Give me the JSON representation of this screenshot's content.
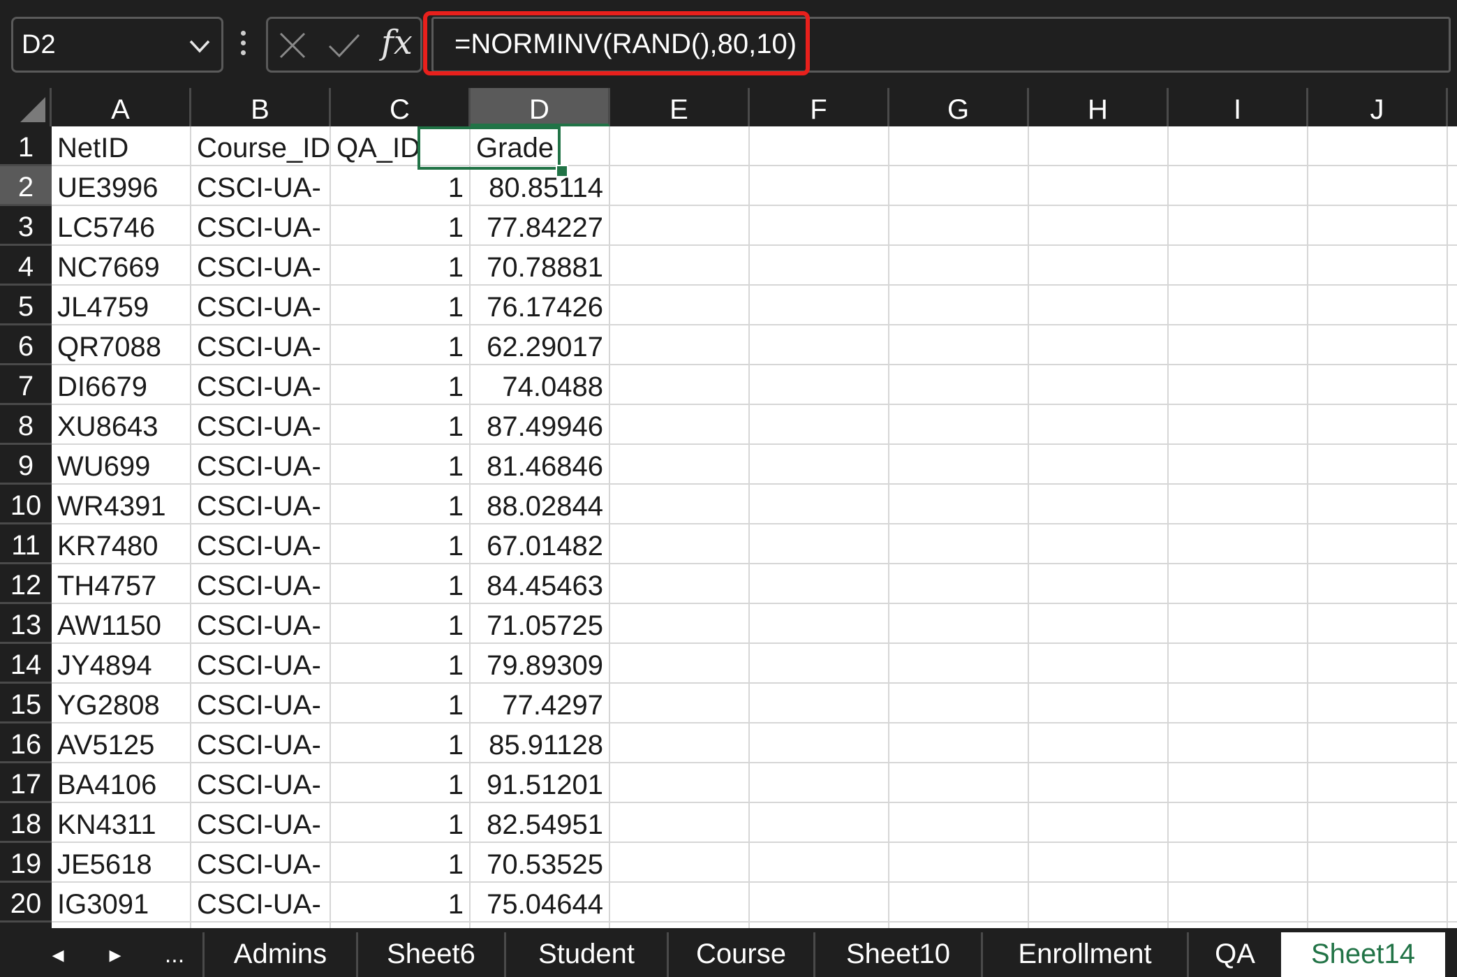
{
  "formula_bar": {
    "name_box": "D2",
    "formula": "=NORMINV(RAND(),80,10)",
    "fx_label": "fx"
  },
  "columns": [
    "A",
    "B",
    "C",
    "D",
    "E",
    "F",
    "G",
    "H",
    "I",
    "J"
  ],
  "selected_column": "D",
  "selected_row": 2,
  "rows": [
    {
      "num": "1",
      "a": "NetID",
      "b": "Course_ID",
      "c": "QA_ID",
      "d": "Grade"
    },
    {
      "num": "2",
      "a": "UE3996",
      "b": "CSCI-UA-",
      "c": "1",
      "d": "80.85114"
    },
    {
      "num": "3",
      "a": "LC5746",
      "b": "CSCI-UA-",
      "c": "1",
      "d": "77.84227"
    },
    {
      "num": "4",
      "a": "NC7669",
      "b": "CSCI-UA-",
      "c": "1",
      "d": "70.78881"
    },
    {
      "num": "5",
      "a": "JL4759",
      "b": "CSCI-UA-",
      "c": "1",
      "d": "76.17426"
    },
    {
      "num": "6",
      "a": "QR7088",
      "b": "CSCI-UA-",
      "c": "1",
      "d": "62.29017"
    },
    {
      "num": "7",
      "a": "DI6679",
      "b": "CSCI-UA-",
      "c": "1",
      "d": "74.0488"
    },
    {
      "num": "8",
      "a": "XU8643",
      "b": "CSCI-UA-",
      "c": "1",
      "d": "87.49946"
    },
    {
      "num": "9",
      "a": "WU699",
      "b": "CSCI-UA-",
      "c": "1",
      "d": "81.46846"
    },
    {
      "num": "10",
      "a": "WR4391",
      "b": "CSCI-UA-",
      "c": "1",
      "d": "88.02844"
    },
    {
      "num": "11",
      "a": "KR7480",
      "b": "CSCI-UA-",
      "c": "1",
      "d": "67.01482"
    },
    {
      "num": "12",
      "a": "TH4757",
      "b": "CSCI-UA-",
      "c": "1",
      "d": "84.45463"
    },
    {
      "num": "13",
      "a": "AW1150",
      "b": "CSCI-UA-",
      "c": "1",
      "d": "71.05725"
    },
    {
      "num": "14",
      "a": "JY4894",
      "b": "CSCI-UA-",
      "c": "1",
      "d": "79.89309"
    },
    {
      "num": "15",
      "a": "YG2808",
      "b": "CSCI-UA-",
      "c": "1",
      "d": "77.4297"
    },
    {
      "num": "16",
      "a": "AV5125",
      "b": "CSCI-UA-",
      "c": "1",
      "d": "85.91128"
    },
    {
      "num": "17",
      "a": "BA4106",
      "b": "CSCI-UA-",
      "c": "1",
      "d": "91.51201"
    },
    {
      "num": "18",
      "a": "KN4311",
      "b": "CSCI-UA-",
      "c": "1",
      "d": "82.54951"
    },
    {
      "num": "19",
      "a": "JE5618",
      "b": "CSCI-UA-",
      "c": "1",
      "d": "70.53525"
    },
    {
      "num": "20",
      "a": "IG3091",
      "b": "CSCI-UA-",
      "c": "1",
      "d": "75.04644"
    }
  ],
  "sheet_nav": {
    "prev": "◂",
    "next": "▸",
    "more": "..."
  },
  "sheet_tabs": [
    "Admins",
    "Sheet6",
    "Student",
    "Course",
    "Sheet10",
    "Enrollment",
    "QA",
    "Sheet14"
  ],
  "active_tab": "Sheet14",
  "colors": {
    "accent": "#217346",
    "highlight_box": "#e8201c",
    "chrome": "#1f1f1f"
  }
}
